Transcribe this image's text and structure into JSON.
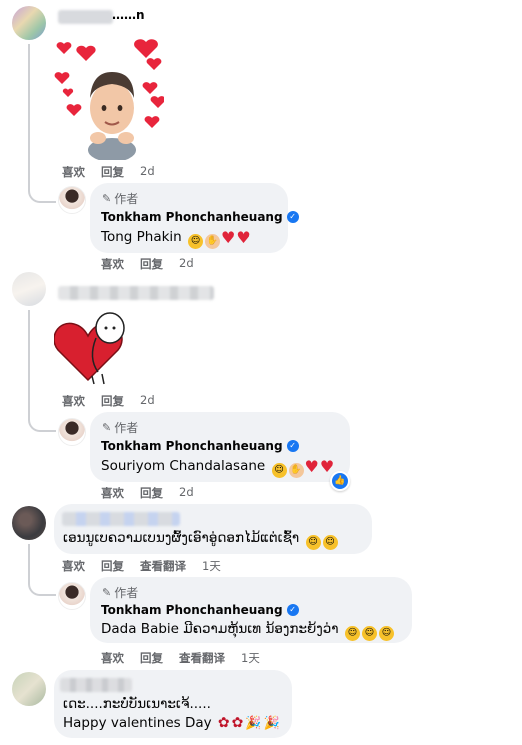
{
  "comments": [
    {
      "blurred_name": "……n",
      "sticker": "emoji-hearts-sticker",
      "actions": {
        "like": "喜欢",
        "reply": "回复",
        "time": "2d"
      },
      "reply": {
        "author_badge": "作者",
        "name": "Tonkham Phonchanheuang",
        "text": "Tong Phakin",
        "emojis": [
          "laugh",
          "pray",
          "heart",
          "heart"
        ],
        "actions": {
          "like": "喜欢",
          "reply": "回复",
          "time": "2d"
        }
      }
    },
    {
      "blurred_name": "",
      "sticker": "heart-hug-sticker",
      "actions": {
        "like": "喜欢",
        "reply": "回复",
        "time": "2d"
      },
      "reply": {
        "author_badge": "作者",
        "name": "Tonkham Phonchanheuang",
        "text": "Souriyom Chandalasane",
        "emojis": [
          "laugh",
          "pray",
          "heart",
          "heart"
        ],
        "actions": {
          "like": "喜欢",
          "reply": "回复",
          "time": "2d"
        }
      }
    },
    {
      "text": "ເອນນູເບຄວາມເບນງຜົ້ງເອົາອູ່ດອກໄມ້ແຕ່ເຊົ້າ",
      "actions": {
        "like": "喜欢",
        "reply": "回复",
        "translate": "查看翻译",
        "time": "1天"
      },
      "reply": {
        "author_badge": "作者",
        "name": "Tonkham Phonchanheuang",
        "text": "Dada Babie ມີຄວາມຫຸ້ນເທ ນ້ອງກະຍ້ງວ່າ",
        "emojis": [
          "laugh",
          "laugh",
          "laugh"
        ],
        "actions": {
          "like": "喜欢",
          "reply": "回复",
          "translate": "查看翻译",
          "time": "1天"
        }
      }
    },
    {
      "line1": "ເດະ....ກະບໍ່ບັນເນາະເຈ້.....",
      "line2": "Happy valentines Day"
    }
  ]
}
